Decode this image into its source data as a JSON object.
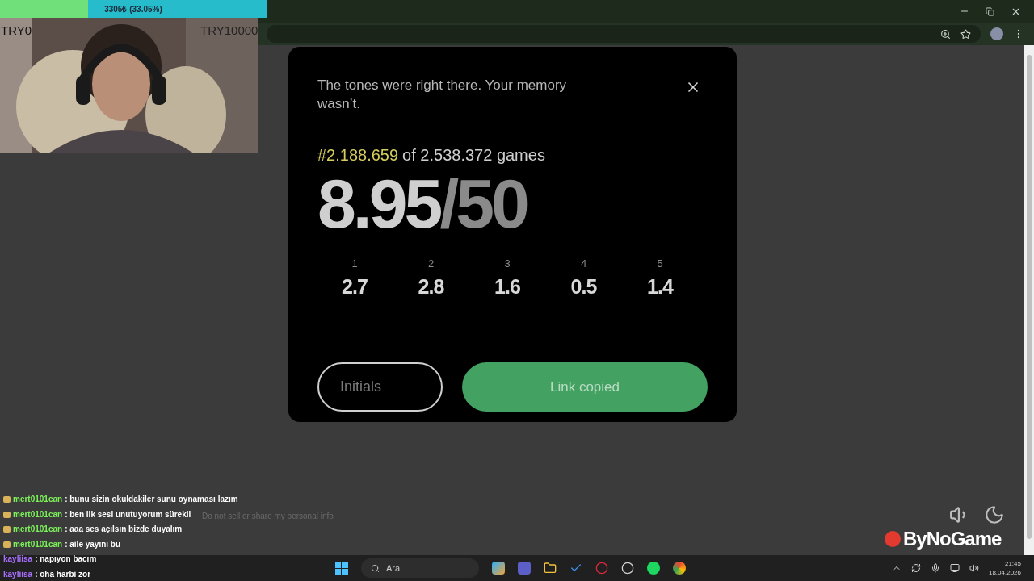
{
  "donation_bar": {
    "text": "3305₺ (33.05%)",
    "level": 0.3305,
    "min_label": "TRY0",
    "max_label": "TRY10000"
  },
  "modal": {
    "message": "The tones were right there. Your memory wasn’t.",
    "rank": "#2.188.659",
    "rank_suffix": "of 2.538.372 games",
    "score": "8.95",
    "score_total": "/50",
    "rounds": [
      {
        "label": "1",
        "score": "2.7"
      },
      {
        "label": "2",
        "score": "2.8"
      },
      {
        "label": "3",
        "score": "1.6"
      },
      {
        "label": "4",
        "score": "0.5"
      },
      {
        "label": "5",
        "score": "1.4"
      }
    ],
    "initials_placeholder": "Initials",
    "share_button": "Link copied"
  },
  "footer_link": "Do not sell or share my personal info",
  "chat": [
    {
      "user": "mert0101can",
      "color": "#7cf25a",
      "badge": true,
      "text": ": bunu sizin okuldakiler sunu oynaması lazım"
    },
    {
      "user": "mert0101can",
      "color": "#7cf25a",
      "badge": true,
      "text": ": ben ilk sesi unutuyorum sürekli"
    },
    {
      "user": "mert0101can",
      "color": "#7cf25a",
      "badge": true,
      "text": ": aaa ses açılsın bizde duyalım"
    },
    {
      "user": "mert0101can",
      "color": "#7cf25a",
      "badge": true,
      "text": ": aile yayını bu"
    },
    {
      "user": "kayliisa",
      "color": "#a970ff",
      "badge": false,
      "text": ": napıyon bacım"
    },
    {
      "user": "kayliisa",
      "color": "#a970ff",
      "badge": false,
      "text": ": oha harbi zor"
    }
  ],
  "logo": "ByNoGame",
  "taskbar": {
    "search_placeholder": "Ara",
    "time": "21:45",
    "date": "18.04.2026"
  }
}
